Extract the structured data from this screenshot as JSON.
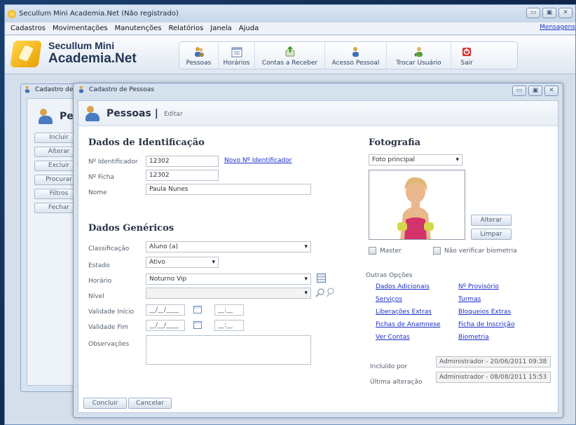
{
  "window": {
    "title": "Secullum Mini Academia.Net (Não registrado)",
    "controls": [
      "▭",
      "▣",
      "✕"
    ]
  },
  "menu": {
    "items": [
      "Cadastros",
      "Movimentações",
      "Manutenções",
      "Relatórios",
      "Janela",
      "Ajuda"
    ],
    "right_link": "Mensagens"
  },
  "logo": {
    "line1": "Secullum Mini",
    "line2": "Academia.Net"
  },
  "toolbar": {
    "buttons": [
      {
        "label": "Pessoas",
        "icon": "people-icon"
      },
      {
        "label": "Horários",
        "icon": "schedule-icon"
      },
      {
        "label": "Contas a Receber",
        "icon": "receivable-icon"
      },
      {
        "label": "Acesso Pessoal",
        "icon": "access-icon"
      },
      {
        "label": "Trocar Usuário",
        "icon": "switch-user-icon"
      },
      {
        "label": "Sair",
        "icon": "exit-icon"
      }
    ]
  },
  "bg_window": {
    "title": "Cadastro de P",
    "heading": "Pess",
    "buttons": [
      "Incluir",
      "Alterar",
      "Excluir",
      "Procurar",
      "Filtros",
      "Fechar"
    ]
  },
  "dialog": {
    "title": "Cadastro de Pessoas",
    "header_title": "Pessoas |",
    "header_mode": "Editar",
    "identificacao": {
      "heading": "Dados de Identificação",
      "id_label": "Nº Identificador",
      "id_value": "12302",
      "new_id_link": "Novo Nº Identificador",
      "ficha_label": "Nº Ficha",
      "ficha_value": "12302",
      "nome_label": "Nome",
      "nome_value": "Paula Nunes"
    },
    "genericos": {
      "heading": "Dados Genéricos",
      "classificacao_label": "Classificação",
      "classificacao_value": "Aluno (a)",
      "estado_label": "Estado",
      "estado_value": "Ativo",
      "horario_label": "Horário",
      "horario_value": "Noturno Vip",
      "nivel_label": "Nível",
      "nivel_value": "",
      "validade_inicio_label": "Validade Início",
      "validade_fim_label": "Validade Fim",
      "date_placeholder": "__/__/____",
      "time_placeholder": "__:__",
      "observacoes_label": "Observações",
      "observacoes_value": ""
    },
    "fotografia": {
      "heading": "Fotografia",
      "select_value": "Foto principal",
      "alterar_button": "Alterar",
      "limpar_button": "Limpar",
      "master_label": "Master",
      "nao_verificar_label": "Não verificar biometria"
    },
    "outras_opcoes": {
      "heading": "Outras Opções",
      "links_left": [
        "Dados Adicionais",
        "Serviços",
        "Liberações Extras",
        "Fichas de Anamnese",
        "Ver Contas"
      ],
      "links_right": [
        "Nº Provisório",
        "Turmas",
        "Bloqueios Extras",
        "Ficha de Inscrição",
        "Biometria"
      ]
    },
    "audit": {
      "incluido_label": "Incluído por",
      "incluido_value": "Administrador - 20/06/2011 09:38",
      "alteracao_label": "Última alteração",
      "alteracao_value": "Administrador - 08/08/2011 15:53"
    },
    "footer": {
      "concluir": "Concluir",
      "cancelar": "Cancelar"
    }
  }
}
